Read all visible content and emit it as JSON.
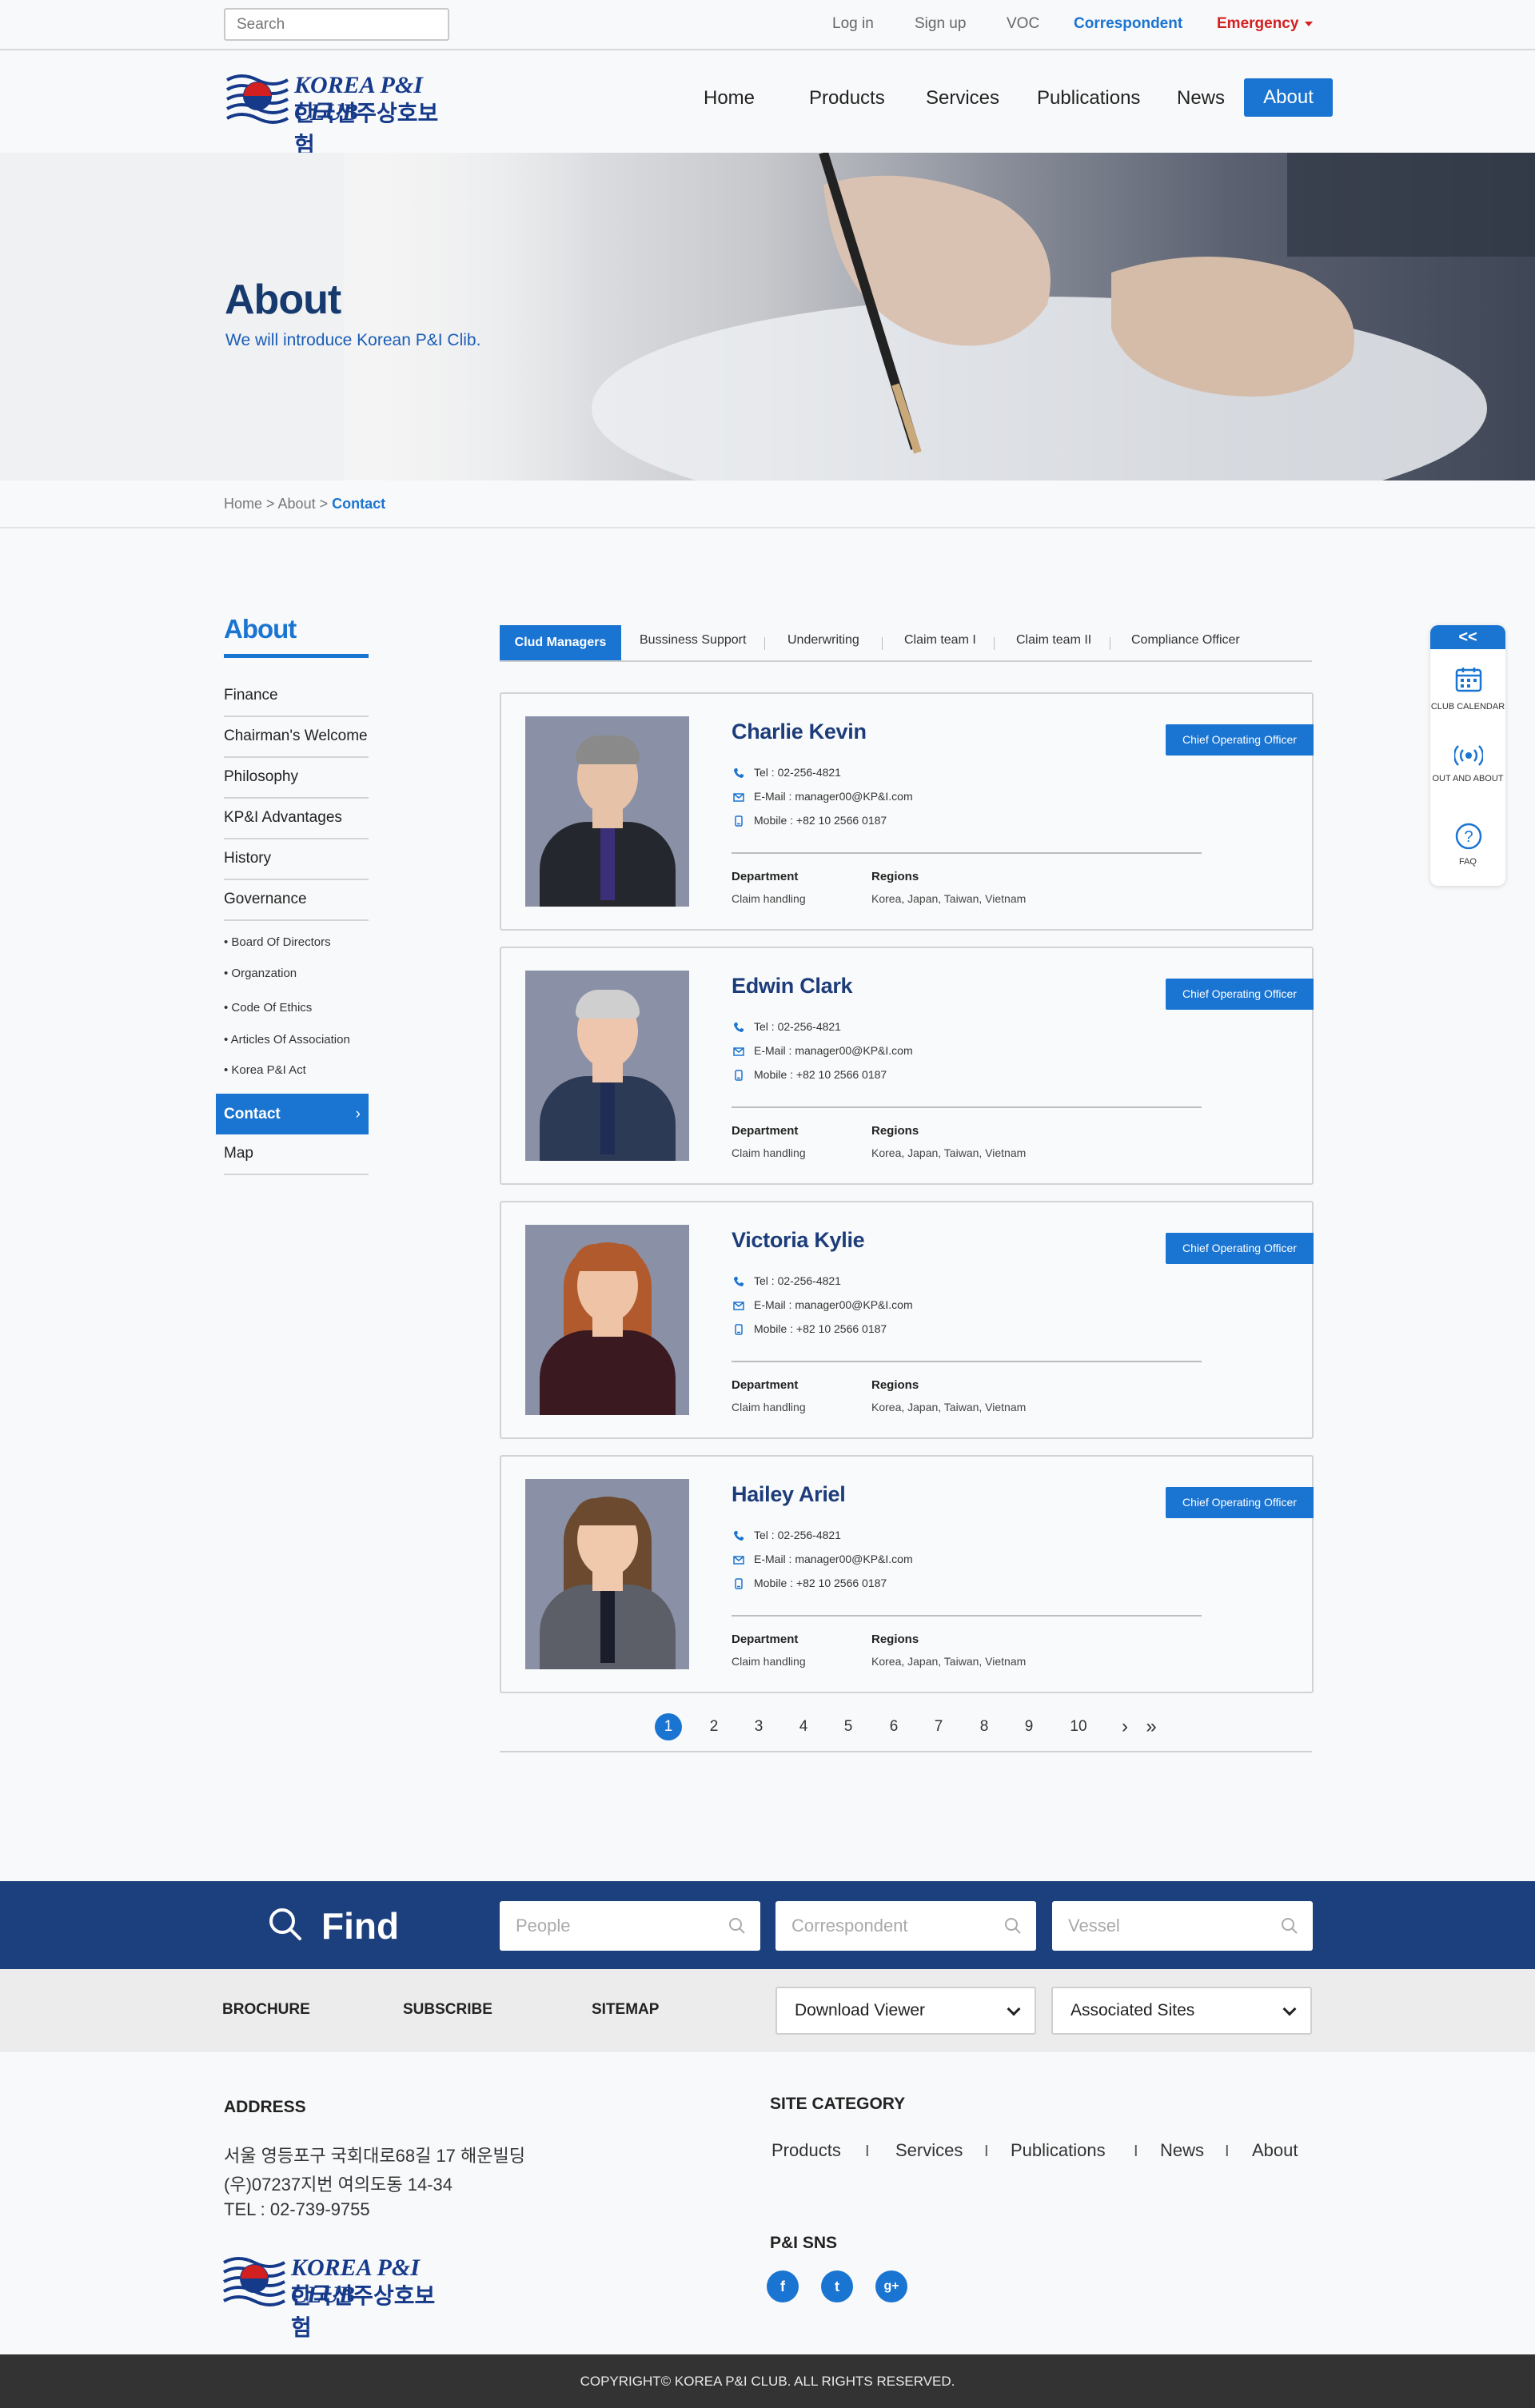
{
  "topbar": {
    "search_placeholder": "Search",
    "links": [
      "Log in",
      "Sign up",
      "VOC",
      "Correspondent",
      "Emergency"
    ]
  },
  "logo": {
    "en": "KOREA P&I CLUB",
    "ko": "한국선주상호보험",
    "mark": "KP&I"
  },
  "nav": {
    "items": [
      "Home",
      "Products",
      "Services",
      "Publications",
      "News"
    ],
    "active": "About"
  },
  "hero": {
    "title": "About",
    "subtitle": "We will introduce Korean P&I Clib."
  },
  "breadcrumb": {
    "path": "Home > About > ",
    "current": "Contact"
  },
  "sidebar": {
    "title": "About",
    "items": [
      "Finance",
      "Chairman's Welcome",
      "Philosophy",
      "KP&I Advantages",
      "History",
      "Governance"
    ],
    "sub_items": [
      "• Board Of Directors",
      "• Organzation",
      "• Code Of Ethics",
      "• Articles Of Association",
      "• Korea P&I Act"
    ],
    "active": "Contact",
    "after": "Map"
  },
  "tabs": [
    "Clud Managers",
    "Bussiness Support",
    "Underwriting",
    "Claim team I",
    "Claim team II",
    "Compliance Officer"
  ],
  "contact_labels": {
    "department": "Department",
    "regions": "Regions"
  },
  "contacts": [
    {
      "name": "Charlie Kevin",
      "role": "Chief Operating Officer",
      "tel": "Tel : 02-256-4821",
      "email": "E-Mail : manager00@KP&I.com",
      "mobile": "Mobile : +82 10 2566 0187",
      "department": "Claim handling",
      "regions": "Korea, Japan, Taiwan, Vietnam"
    },
    {
      "name": "Edwin Clark",
      "role": "Chief Operating Officer",
      "tel": "Tel : 02-256-4821",
      "email": "E-Mail : manager00@KP&I.com",
      "mobile": "Mobile : +82 10 2566 0187",
      "department": "Claim handling",
      "regions": "Korea, Japan, Taiwan, Vietnam"
    },
    {
      "name": "Victoria Kylie",
      "role": "Chief Operating Officer",
      "tel": "Tel : 02-256-4821",
      "email": "E-Mail : manager00@KP&I.com",
      "mobile": "Mobile : +82 10 2566 0187",
      "department": "Claim handling",
      "regions": "Korea, Japan, Taiwan, Vietnam"
    },
    {
      "name": "Hailey Ariel",
      "role": "Chief Operating Officer",
      "tel": "Tel : 02-256-4821",
      "email": "E-Mail : manager00@KP&I.com",
      "mobile": "Mobile : +82 10 2566 0187",
      "department": "Claim handling",
      "regions": "Korea, Japan, Taiwan, Vietnam"
    }
  ],
  "pagination": {
    "pages": [
      "1",
      "2",
      "3",
      "4",
      "5",
      "6",
      "7",
      "8",
      "9",
      "10"
    ],
    "current": "1",
    "next": "›",
    "last": "»"
  },
  "widget": {
    "collapse": "<<",
    "calendar": "CLUB CALENDAR",
    "out": "OUT AND ABOUT",
    "faq": "FAQ"
  },
  "find": {
    "title": "Find",
    "people": "People",
    "correspondent": "Correspondent",
    "vessel": "Vessel"
  },
  "strip": {
    "links": [
      "BROCHURE",
      "SUBSCRIBE",
      "SITEMAP"
    ],
    "download": "Download Viewer",
    "associated": "Associated Sites"
  },
  "footer": {
    "address_title": "ADDRESS",
    "address": [
      "서울 영등포구 국회대로68길 17 해운빌딩",
      "(우)07237지번 여의도동 14-34",
      "TEL : 02-739-9755"
    ],
    "site_category_title": "SITE CATEGORY",
    "site_category": [
      "Products",
      "Services",
      "Publications",
      "News",
      "About"
    ],
    "sns_title": "P&I SNS",
    "sns": [
      "f",
      "t",
      "g+"
    ],
    "copyright": "COPYRIGHT©  KOREA P&I CLUB. ALL RIGHTS RESERVED."
  },
  "colors": {
    "brand_blue": "#1a74d1",
    "navy": "#1c3f7d",
    "emergency": "#d21f1f",
    "footer_dark": "#333333"
  }
}
